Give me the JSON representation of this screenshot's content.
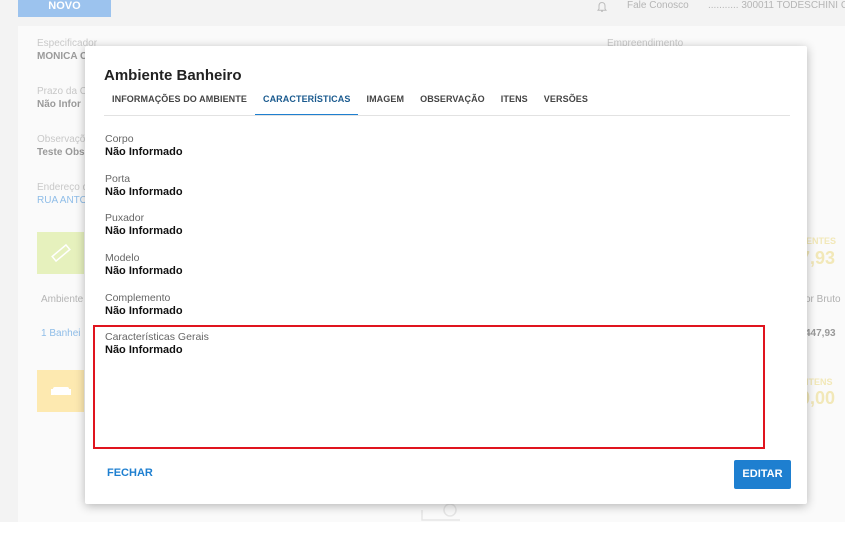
{
  "topbar": {
    "novo_label": "NOVO",
    "fale_conosco": "Fale Conosco",
    "user_label": "........... 300011 TODESCHINI C"
  },
  "background": {
    "especificador_label": "Especificador",
    "especificador_value": "MONICA C",
    "empreendimento_label": "Empreendimento",
    "prazo_label": "Prazo da C",
    "prazo_value": "Não Infor",
    "observacao_label": "Observaçõ",
    "observacao_value": "Teste Obs",
    "endereco_label": "Endereço d",
    "endereco_value": "RUA ANTO",
    "ambiente_header": "Ambiente",
    "ambiente_row": "1 Banhei",
    "right_top_label": "ENTES",
    "right_top_value": "7,93",
    "bruto_label": "or Bruto",
    "bruto_value": "447,93",
    "right_bottom_label": "ITENS",
    "right_bottom_value": "0,00"
  },
  "modal": {
    "title": "Ambiente Banheiro",
    "tabs": [
      {
        "label": "INFORMAÇÕES DO AMBIENTE",
        "active": false
      },
      {
        "label": "CARACTERÍSTICAS",
        "active": true
      },
      {
        "label": "IMAGEM",
        "active": false
      },
      {
        "label": "OBSERVAÇÃO",
        "active": false
      },
      {
        "label": "ITENS",
        "active": false
      },
      {
        "label": "VERSÕES",
        "active": false
      }
    ],
    "fields": [
      {
        "label": "Corpo",
        "value": "Não Informado"
      },
      {
        "label": "Porta",
        "value": "Não Informado"
      },
      {
        "label": "Puxador",
        "value": "Não Informado"
      },
      {
        "label": "Modelo",
        "value": "Não Informado"
      },
      {
        "label": "Complemento",
        "value": "Não Informado"
      },
      {
        "label": "Características Gerais",
        "value": "Não Informado"
      }
    ],
    "close_label": "FECHAR",
    "edit_label": "EDITAR"
  },
  "colors": {
    "accent": "#1e7fd0",
    "highlight": "#e0141e"
  },
  "icons": [
    "bell-icon",
    "ruler-icon",
    "sofa-icon",
    "search-icon"
  ]
}
